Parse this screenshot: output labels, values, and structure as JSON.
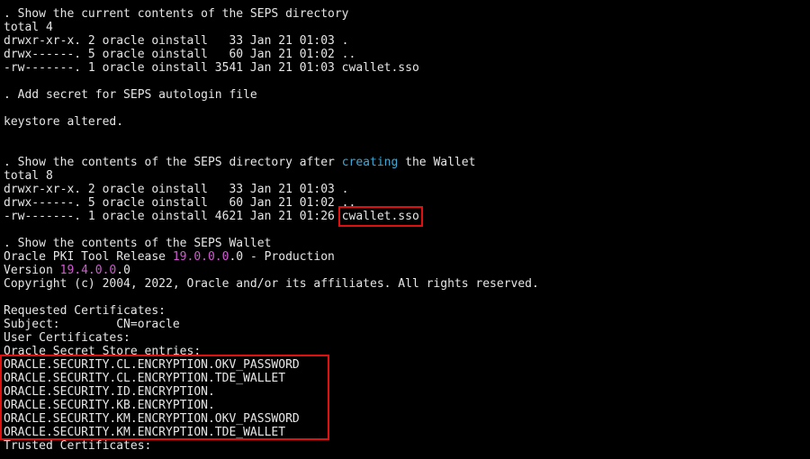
{
  "terminal": {
    "section1": {
      "header": ". Show the current contents of the SEPS directory",
      "total": "total 4",
      "rows": [
        "drwxr-xr-x. 2 oracle oinstall   33 Jan 21 01:03 .",
        "drwx------. 5 oracle oinstall   60 Jan 21 01:02 ..",
        "-rw-------. 1 oracle oinstall 3541 Jan 21 01:03 cwallet.sso"
      ]
    },
    "section2": {
      "header": ". Add secret for SEPS autologin file",
      "result": "keystore altered."
    },
    "section3": {
      "header_pre": ". Show the contents of the SEPS directory after ",
      "header_keyword": "creating",
      "header_post": " the Wallet",
      "total": "total 8",
      "rows": [
        "drwxr-xr-x. 2 oracle oinstall   33 Jan 21 01:03 .",
        "drwx------. 5 oracle oinstall   60 Jan 21 01:02 .."
      ],
      "last_row_prefix": "-rw-------. 1 oracle oinstall 4621 Jan 21 01:26 ",
      "last_row_file": "cwallet.sso"
    },
    "section4": {
      "header": ". Show the contents of the SEPS Wallet",
      "tool_pre": "Oracle PKI Tool Release ",
      "tool_version_colored": "19.0.0.0",
      "tool_post": ".0 - Production",
      "version_pre": "Version ",
      "version_colored": "19.4.0.0",
      "version_post": ".0",
      "copyright": "Copyright (c) 2004, 2022, Oracle and/or its affiliates. All rights reserved.",
      "requested_certs": "Requested Certificates:",
      "subject": "Subject:        CN=oracle",
      "user_certs": "User Certificates:",
      "secret_store": "Oracle Secret Store entries:",
      "entries": [
        "ORACLE.SECURITY.CL.ENCRYPTION.OKV_PASSWORD",
        "ORACLE.SECURITY.CL.ENCRYPTION.TDE_WALLET",
        "ORACLE.SECURITY.ID.ENCRYPTION.",
        "ORACLE.SECURITY.KB.ENCRYPTION.",
        "ORACLE.SECURITY.KM.ENCRYPTION.OKV_PASSWORD",
        "ORACLE.SECURITY.KM.ENCRYPTION.TDE_WALLET"
      ],
      "trusted_certs": "Trusted Certificates:"
    }
  },
  "colors": {
    "background": "#000000",
    "text": "#e6e6e6",
    "keyword": "#3fa9d8",
    "version": "#d25ad2",
    "highlight_box": "#e01010"
  }
}
